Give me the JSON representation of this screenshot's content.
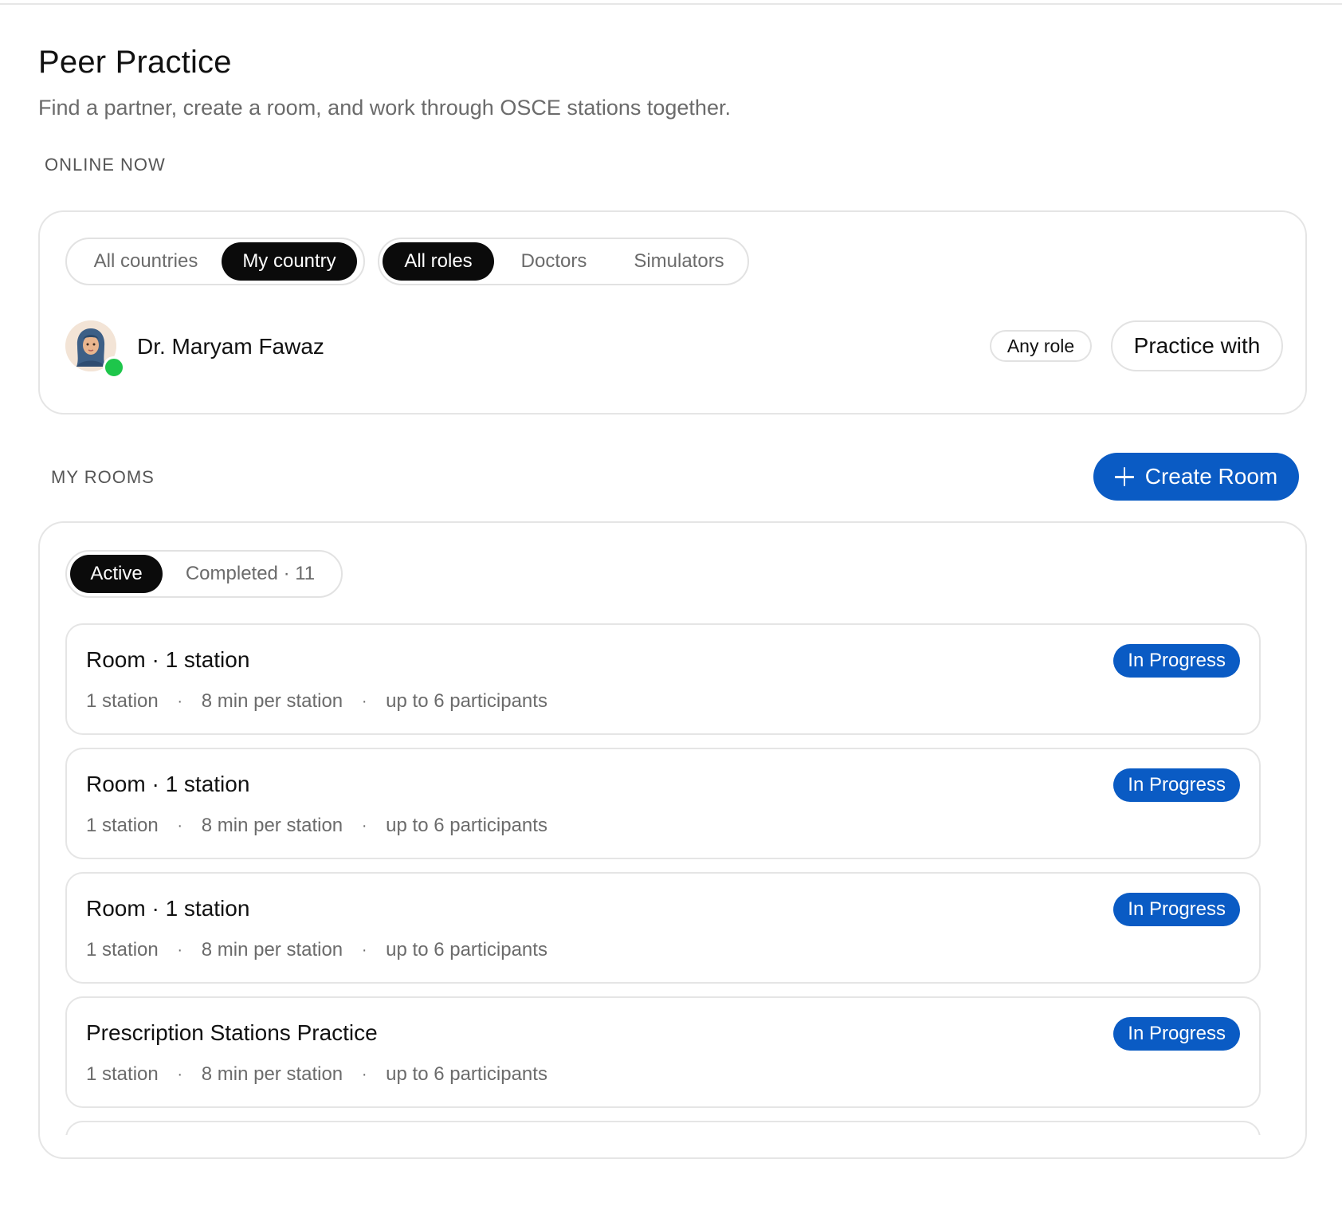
{
  "page": {
    "title": "Peer Practice",
    "subtitle": "Find a partner, create a room, and work through OSCE stations together."
  },
  "online_now": {
    "section_label": "ONLINE NOW",
    "country_filter": {
      "options": [
        "All countries",
        "My country"
      ],
      "selected": "My country"
    },
    "role_filter": {
      "options": [
        "All roles",
        "Doctors",
        "Simulators"
      ],
      "selected": "All roles"
    },
    "peers": [
      {
        "name": "Dr. Maryam Fawaz",
        "role_badge": "Any role",
        "action_label": "Practice with",
        "status": "online",
        "avatar_icon": "avatar-hijab-icon"
      }
    ]
  },
  "my_rooms": {
    "section_label": "MY ROOMS",
    "create_button_label": "Create Room",
    "tabs": [
      {
        "label": "Active",
        "active": true
      },
      {
        "label": "Completed · 11",
        "active": false
      }
    ],
    "rooms": [
      {
        "title": "Room · 1 station",
        "status": "In Progress",
        "stations": "1 station",
        "duration": "8 min per station",
        "participants": "up to 6 participants"
      },
      {
        "title": "Room · 1 station",
        "status": "In Progress",
        "stations": "1 station",
        "duration": "8 min per station",
        "participants": "up to 6 participants"
      },
      {
        "title": "Room · 1 station",
        "status": "In Progress",
        "stations": "1 station",
        "duration": "8 min per station",
        "participants": "up to 6 participants"
      },
      {
        "title": "Prescription Stations Practice",
        "status": "In Progress",
        "stations": "1 station",
        "duration": "8 min per station",
        "participants": "up to 6 participants"
      },
      {
        "title": "",
        "status": "",
        "stations": "",
        "duration": "",
        "participants": ""
      }
    ],
    "meta_separator": "·"
  },
  "colors": {
    "accent": "#0a5bc4",
    "active_pill": "#0b0b0b",
    "online": "#1ec64b",
    "muted_text": "#6b6b6b",
    "border": "#e5e5e5"
  }
}
